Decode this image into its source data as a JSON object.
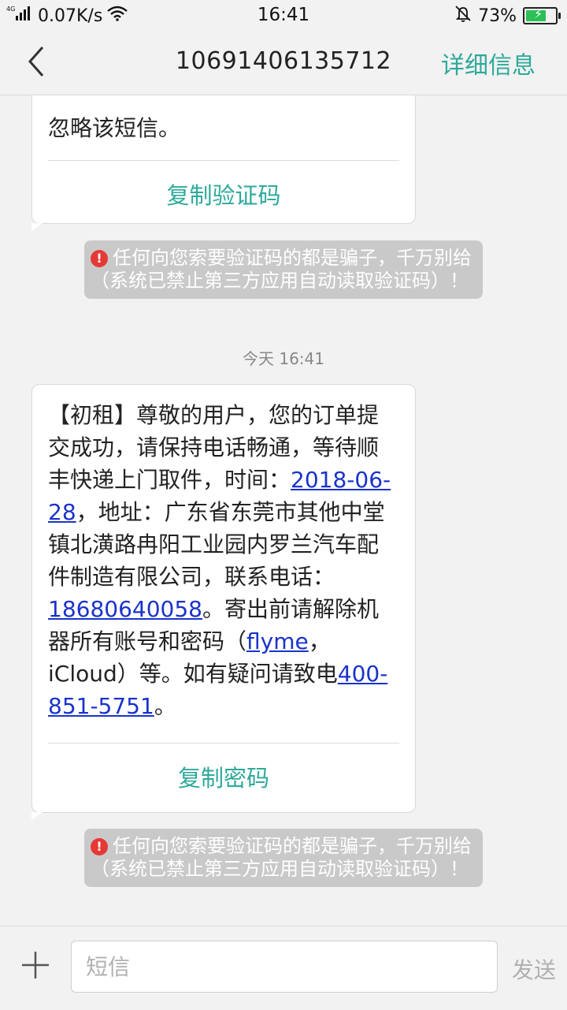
{
  "status": {
    "network": "4G",
    "speed": "0.07K/s",
    "time": "16:41",
    "battery": "73%",
    "battery_level": 0.73
  },
  "header": {
    "title": "10691406135712",
    "detail_label": "详细信息"
  },
  "messages": {
    "m1": {
      "partial": "忽略该短信。",
      "copy_label": "复制验证码"
    },
    "warning1": "任何向您索要验证码的都是骗子，千万别给（系统已禁止第三方应用自动读取验证码）！",
    "timestamp": "今天 16:41",
    "m2": {
      "t1": "【初租】尊敬的用户，您的订单提交成功，请保持电话畅通，等待顺丰快递上门取件，时间：",
      "link_date": "2018-06-28",
      "t2": "，地址：广东省东莞市其他中堂镇北潢路冉阳工业园内罗兰汽车配件制造有限公司，联系电话：",
      "link_phone": "18680640058",
      "t3": "。寄出前请解除机器所有账号和密码（",
      "link_flyme": "flyme",
      "t4": "，iCloud）等。如有疑问请致电",
      "link_hotline": "400-851-5751",
      "t5": "。",
      "copy_label": "复制密码"
    },
    "warning2": "任何向您索要验证码的都是骗子，千万别给（系统已禁止第三方应用自动读取验证码）！"
  },
  "input": {
    "placeholder": "短信",
    "send_label": "发送"
  },
  "colors": {
    "accent": "#2ea99a",
    "link": "#1a33cc",
    "warning_bg": "#c9c9c9",
    "warning_icon": "#e53935"
  }
}
